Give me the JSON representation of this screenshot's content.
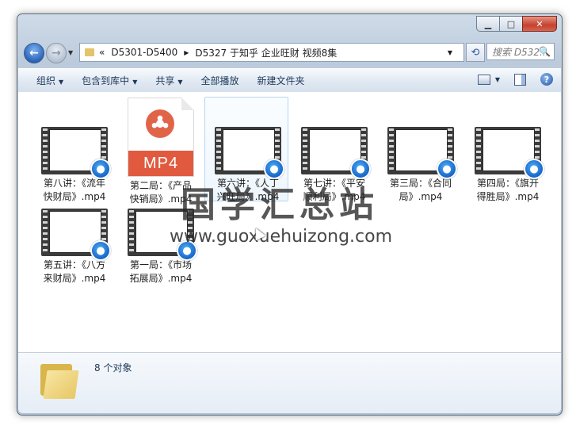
{
  "window": {
    "caption_buttons": [
      "minimize",
      "maximize",
      "close"
    ]
  },
  "nav": {
    "breadcrumb_prefix": "«",
    "breadcrumb": [
      "D5301-D5400",
      "D5327 于知乎 企业旺财 视频8集"
    ],
    "search_placeholder": "搜索 D532...",
    "search_icon": "🔍"
  },
  "toolbar": {
    "organize": "组织",
    "include_library": "包含到库中",
    "share": "共享",
    "play_all": "全部播放",
    "new_folder": "新建文件夹",
    "help": "?"
  },
  "files": [
    {
      "name": "第八讲：《流年快财局》.mp4",
      "line1": "第八讲：《流年",
      "line2": "快财局》.mp4",
      "icon": "video-thumbnail"
    },
    {
      "name": "第二局：《产品快销局》.mp4",
      "line1": "第二局：《产品",
      "line2": "快销局》.mp4",
      "icon": "mp4-file",
      "icon_label": "MP4"
    },
    {
      "name": "第六讲：《人丁兴旺局》.mp4",
      "line1": "第六讲：《人丁",
      "line2": "兴旺局》.mp4",
      "icon": "video-thumbnail",
      "selected": true
    },
    {
      "name": "第七讲：《平安顺利局》.mp4",
      "line1": "第七讲：《平安",
      "line2": "顺利局》.mp4",
      "icon": "video-thumbnail"
    },
    {
      "name": "第三局：《合同局》.mp4",
      "line1": "第三局：《合同",
      "line2": "局》.mp4",
      "icon": "video-thumbnail"
    },
    {
      "name": "第四局：《旗开得胜局》.mp4",
      "line1": "第四局：《旗开",
      "line2": "得胜局》.mp4",
      "icon": "video-thumbnail"
    },
    {
      "name": "第五讲：《八方来财局》.mp4",
      "line1": "第五讲：《八方",
      "line2": "来财局》.mp4",
      "icon": "video-thumbnail"
    },
    {
      "name": "第一局：《市场拓展局》.mp4",
      "line1": "第一局：《市场",
      "line2": "拓展局》.mp4",
      "icon": "video-thumbnail"
    }
  ],
  "watermark": {
    "line1": "国学汇总站",
    "line2": "www.guoxuehuizong.com"
  },
  "status": {
    "count": "8 个对象"
  }
}
